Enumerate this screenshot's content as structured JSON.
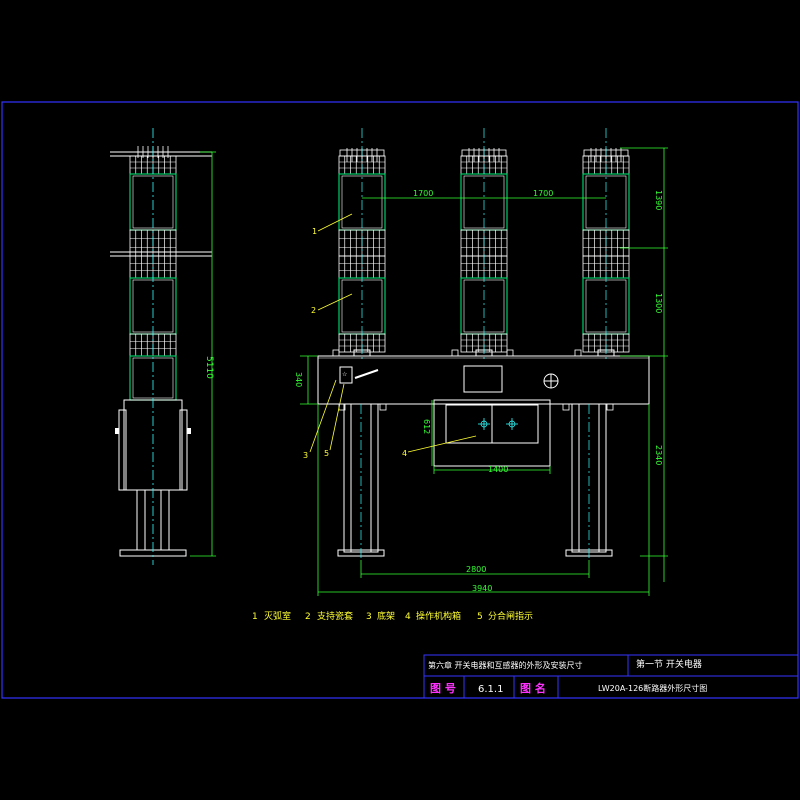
{
  "colors": {
    "background": "#000000",
    "frame": "#3333ff",
    "outline": "#ffffff",
    "dimension": "#33ff33",
    "centerline": "#33ffff",
    "insulator_body": "#00cc66",
    "legend": "#ffff33",
    "title_block": "#ff33ff",
    "callout": "#ffff33"
  },
  "dimensions": {
    "side_height": "5110",
    "top_section": "1390",
    "mid_section": "1300",
    "lower_height": "2340",
    "pole_spacing_left": "1700",
    "pole_spacing_right": "1700",
    "frame_height": "340",
    "cabinet_height": "612",
    "cabinet_width": "1400",
    "leg_spacing": "2800",
    "overall_width": "3940"
  },
  "callouts": [
    "1",
    "2",
    "3",
    "5",
    "4"
  ],
  "legend": {
    "items": [
      {
        "num": "1",
        "label": "灭弧室"
      },
      {
        "num": "2",
        "label": "支持瓷套"
      },
      {
        "num": "3",
        "label": "底架"
      },
      {
        "num": "4",
        "label": "操作机构箱"
      },
      {
        "num": "5",
        "label": "分合闸指示"
      }
    ]
  },
  "title_block": {
    "chapter": "第六章  开关电器和互感器的外形及安装尺寸",
    "section": "第一节  开关电器",
    "drawing_no_label": "图  号",
    "drawing_no": "6.1.1",
    "drawing_name_label": "图  名",
    "drawing_name": "LW20A-126断路器外形尺寸图"
  }
}
